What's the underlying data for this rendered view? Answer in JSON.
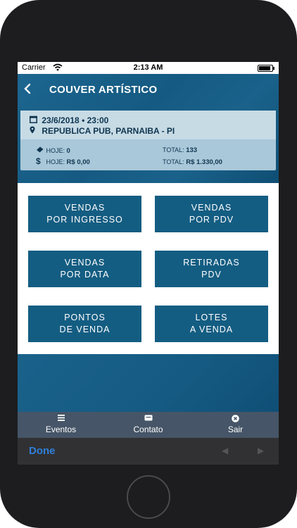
{
  "status_bar": {
    "carrier": "Carrier",
    "time": "2:13 AM"
  },
  "header": {
    "title": "COUVER ARTÍSTICO",
    "back_icon": "chevron-left-icon"
  },
  "event": {
    "date": "23/6/2018 • 23:00",
    "venue": "REPUBLICA PUB, PARNAIBA - PI",
    "stats": {
      "tickets_today_label": "HOJE:",
      "tickets_today_value": "0",
      "tickets_total_label": "TOTAL:",
      "tickets_total_value": "133",
      "money_today_label": "HOJE:",
      "money_today_value": "R$ 0,00",
      "money_total_label": "TOTAL:",
      "money_total_value": "R$ 1.330,00"
    }
  },
  "menu": {
    "b1": {
      "line1": "VENDAS",
      "line2": "POR INGRESSO"
    },
    "b2": {
      "line1": "VENDAS",
      "line2": "POR PDV"
    },
    "b3": {
      "line1": "VENDAS",
      "line2": "POR DATA"
    },
    "b4": {
      "line1": "RETIRADAS",
      "line2": "PDV"
    },
    "b5": {
      "line1": "PONTOS",
      "line2": "DE VENDA"
    },
    "b6": {
      "line1": "LOTES",
      "line2": "A VENDA"
    }
  },
  "tabbar": {
    "eventos": {
      "label": "Eventos",
      "icon": "list-icon"
    },
    "contato": {
      "label": "Contato",
      "icon": "message-icon"
    },
    "sair": {
      "label": "Sair",
      "icon": "close-circle-icon"
    }
  },
  "keyboard_bar": {
    "done_label": "Done"
  },
  "colors": {
    "accent": "#145d82",
    "card": "#c7dbe5",
    "tabbar": "#465567",
    "done": "#2f7fd9"
  }
}
